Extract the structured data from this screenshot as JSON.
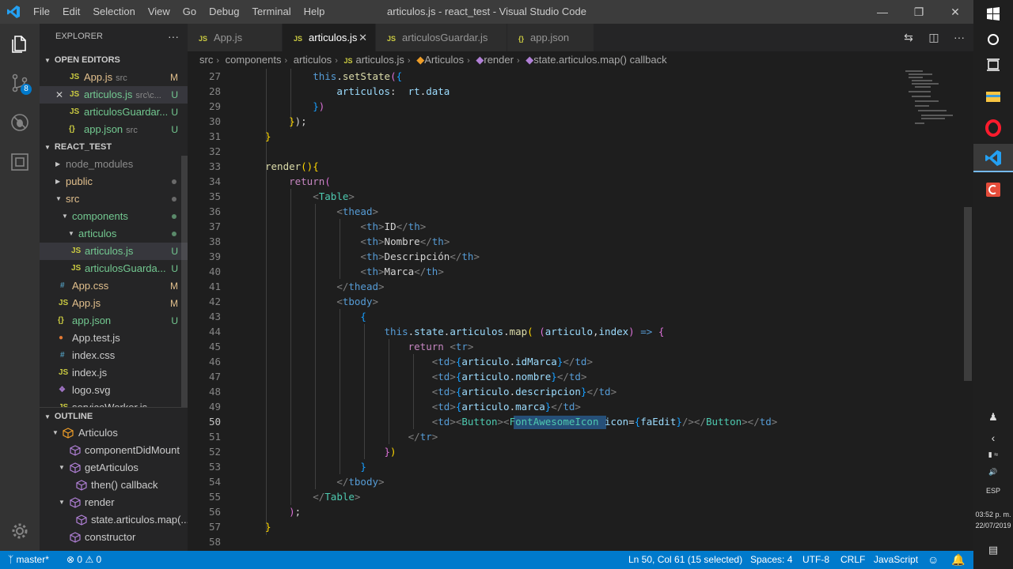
{
  "window": {
    "title": "articulos.js - react_test - Visual Studio Code",
    "menu": [
      "File",
      "Edit",
      "Selection",
      "View",
      "Go",
      "Debug",
      "Terminal",
      "Help"
    ]
  },
  "activity_bar": {
    "items": [
      "explorer-icon",
      "source-control-icon",
      "debug-icon",
      "extensions-icon",
      "settings-gear-icon"
    ],
    "scm_badge": "8"
  },
  "sidebar": {
    "title": "EXPLORER",
    "open_editors": {
      "header": "OPEN EDITORS",
      "items": [
        {
          "icon": "JS",
          "name": "App.js",
          "path": "src",
          "status": "M"
        },
        {
          "icon": "JS",
          "name": "articulos.js",
          "path": "src\\c...",
          "status": "U"
        },
        {
          "icon": "JS",
          "name": "articulosGuardar...",
          "path": "",
          "status": "U"
        },
        {
          "icon": "{}",
          "name": "app.json",
          "path": "src",
          "status": "U"
        }
      ]
    },
    "project": {
      "header": "REACT_TEST",
      "items": [
        {
          "name": "node_modules",
          "type": "folder"
        },
        {
          "name": "public",
          "type": "folder"
        },
        {
          "name": "src",
          "type": "folder"
        },
        {
          "name": "components",
          "type": "folder"
        },
        {
          "name": "articulos",
          "type": "folder"
        },
        {
          "name": "articulos.js",
          "icon": "JS",
          "status": "U"
        },
        {
          "name": "articulosGuarda...",
          "icon": "JS",
          "status": "U"
        },
        {
          "name": "App.css",
          "icon": "#",
          "status": "M"
        },
        {
          "name": "App.js",
          "icon": "JS",
          "status": "M"
        },
        {
          "name": "app.json",
          "icon": "{}",
          "status": "U"
        },
        {
          "name": "App.test.js",
          "icon": "JS",
          "status": ""
        },
        {
          "name": "index.css",
          "icon": "#",
          "status": ""
        },
        {
          "name": "index.js",
          "icon": "JS",
          "status": ""
        },
        {
          "name": "logo.svg",
          "icon": "svg",
          "status": ""
        },
        {
          "name": "serviceWorker.js",
          "icon": "JS",
          "status": ""
        }
      ]
    },
    "outline": {
      "header": "OUTLINE",
      "items": [
        {
          "name": "Articulos"
        },
        {
          "name": "componentDidMount"
        },
        {
          "name": "getArticulos"
        },
        {
          "name": "then() callback"
        },
        {
          "name": "render"
        },
        {
          "name": "state.articulos.map(..."
        },
        {
          "name": "constructor"
        }
      ]
    }
  },
  "tabs": [
    {
      "icon": "JS",
      "label": "App.js"
    },
    {
      "icon": "JS",
      "label": "articulos.js"
    },
    {
      "icon": "JS",
      "label": "articulosGuardar.js"
    },
    {
      "icon": "{}",
      "label": "app.json"
    }
  ],
  "breadcrumb": [
    "src",
    "components",
    "articulos",
    "articulos.js",
    "Articulos",
    "render",
    "state.articulos.map() callback"
  ],
  "editor": {
    "line_numbers": [
      "27",
      "28",
      "29",
      "30",
      "31",
      "32",
      "33",
      "34",
      "35",
      "36",
      "37",
      "38",
      "39",
      "40",
      "41",
      "42",
      "43",
      "44",
      "45",
      "46",
      "47",
      "48",
      "49",
      "50",
      "51",
      "52",
      "53",
      "54",
      "55",
      "56",
      "57",
      "58"
    ]
  },
  "status_bar": {
    "branch": "master*",
    "errors": "0",
    "warnings": "0",
    "position": "Ln 50, Col 61 (15 selected)",
    "spaces": "Spaces: 4",
    "encoding": "UTF-8",
    "eol": "CRLF",
    "language": "JavaScript"
  },
  "taskbar": {
    "lang": "ESP",
    "time": "03:52 p. m.",
    "date": "22/07/2019"
  },
  "colors": {
    "accent": "#007acc",
    "modified": "#e2c08d",
    "untracked": "#73c991"
  }
}
